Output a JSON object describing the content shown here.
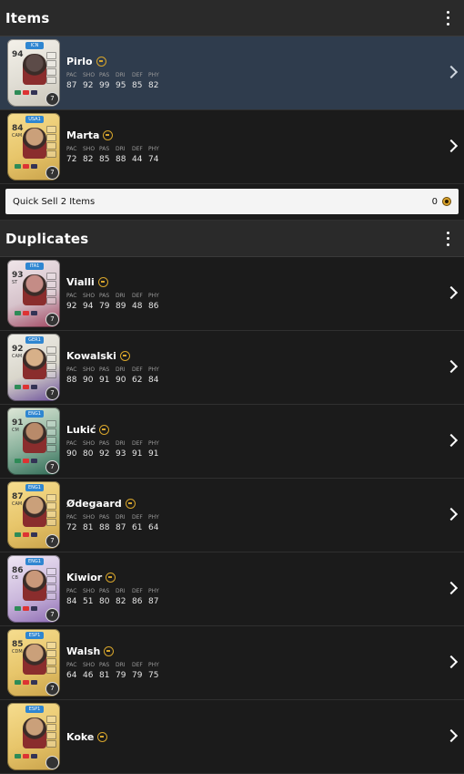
{
  "colors": {
    "selected_row": "#2f3c4d",
    "accent_gold": "#d7a52c",
    "background": "#161616"
  },
  "items_section": {
    "title": "Items",
    "menu_icon": "kebab-menu-icon",
    "players": [
      {
        "name": "Pirlo",
        "tag": "ICN",
        "rating": "94",
        "position": "",
        "chem": "7",
        "stats": [
          "87",
          "92",
          "99",
          "95",
          "85",
          "82"
        ],
        "card_style": "icon",
        "selected": true
      },
      {
        "name": "Marta",
        "tag": "USA1",
        "rating": "84",
        "position": "CAM",
        "chem": "7",
        "stats": [
          "72",
          "82",
          "85",
          "88",
          "44",
          "74"
        ],
        "card_style": "gold",
        "selected": false
      }
    ],
    "quick_sell": {
      "label": "Quick Sell 2 Items",
      "value": "0"
    }
  },
  "stat_labels": [
    "PAC",
    "SHO",
    "PAS",
    "DRI",
    "DEF",
    "PHY"
  ],
  "duplicates_section": {
    "title": "Duplicates",
    "menu_icon": "kebab-menu-icon",
    "players": [
      {
        "name": "Vialli",
        "tag": "ITA1",
        "rating": "93",
        "position": "ST",
        "chem": "7",
        "stats": [
          "92",
          "94",
          "79",
          "89",
          "48",
          "86"
        ],
        "card_style": "hero"
      },
      {
        "name": "Kowalski",
        "tag": "GER1",
        "rating": "92",
        "position": "CAM",
        "chem": "7",
        "stats": [
          "88",
          "90",
          "91",
          "90",
          "62",
          "84"
        ],
        "card_style": "silver"
      },
      {
        "name": "Lukić",
        "tag": "ENG1",
        "rating": "91",
        "position": "CM",
        "chem": "7",
        "stats": [
          "90",
          "80",
          "92",
          "93",
          "91",
          "91"
        ],
        "card_style": "green"
      },
      {
        "name": "Ødegaard",
        "tag": "ENG1",
        "rating": "87",
        "position": "CAM",
        "chem": "7",
        "stats": [
          "72",
          "81",
          "88",
          "87",
          "61",
          "64"
        ],
        "card_style": "gold"
      },
      {
        "name": "Kiwior",
        "tag": "ENG1",
        "rating": "86",
        "position": "CB",
        "chem": "7",
        "stats": [
          "84",
          "51",
          "80",
          "82",
          "86",
          "87"
        ],
        "card_style": "purple"
      },
      {
        "name": "Walsh",
        "tag": "ESP1",
        "rating": "85",
        "position": "CDM",
        "chem": "7",
        "stats": [
          "64",
          "46",
          "81",
          "79",
          "79",
          "75"
        ],
        "card_style": "gold"
      },
      {
        "name": "Koke",
        "tag": "ESP1",
        "rating": "",
        "position": "",
        "chem": "",
        "stats": [],
        "card_style": "gold"
      }
    ]
  }
}
